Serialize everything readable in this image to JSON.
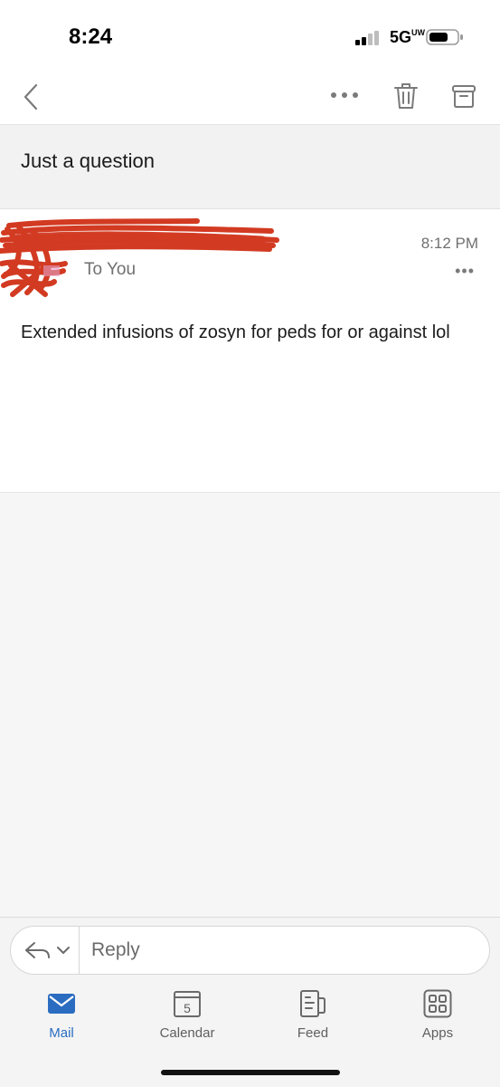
{
  "status_bar": {
    "time": "8:24",
    "network": "5G",
    "network_sup": "UW"
  },
  "nav": {
    "back_icon": "chevron-left-icon",
    "more_icon": "ellipsis-icon",
    "delete_icon": "trash-icon",
    "archive_icon": "archive-icon"
  },
  "email": {
    "subject": "Just a question",
    "recipient": "To You",
    "time": "8:12 PM",
    "more": "•••",
    "body": "Extended infusions of zosyn for peds   for or against lol"
  },
  "reply": {
    "label": "Reply"
  },
  "tabs": [
    {
      "label": "Mail",
      "icon": "envelope-icon",
      "active": true
    },
    {
      "label": "Calendar",
      "icon": "calendar-icon",
      "day": "5",
      "active": false
    },
    {
      "label": "Feed",
      "icon": "feed-icon",
      "active": false
    },
    {
      "label": "Apps",
      "icon": "apps-grid-icon",
      "active": false
    }
  ],
  "colors": {
    "accent": "#2a6cc0",
    "redaction": "#d23a22"
  }
}
